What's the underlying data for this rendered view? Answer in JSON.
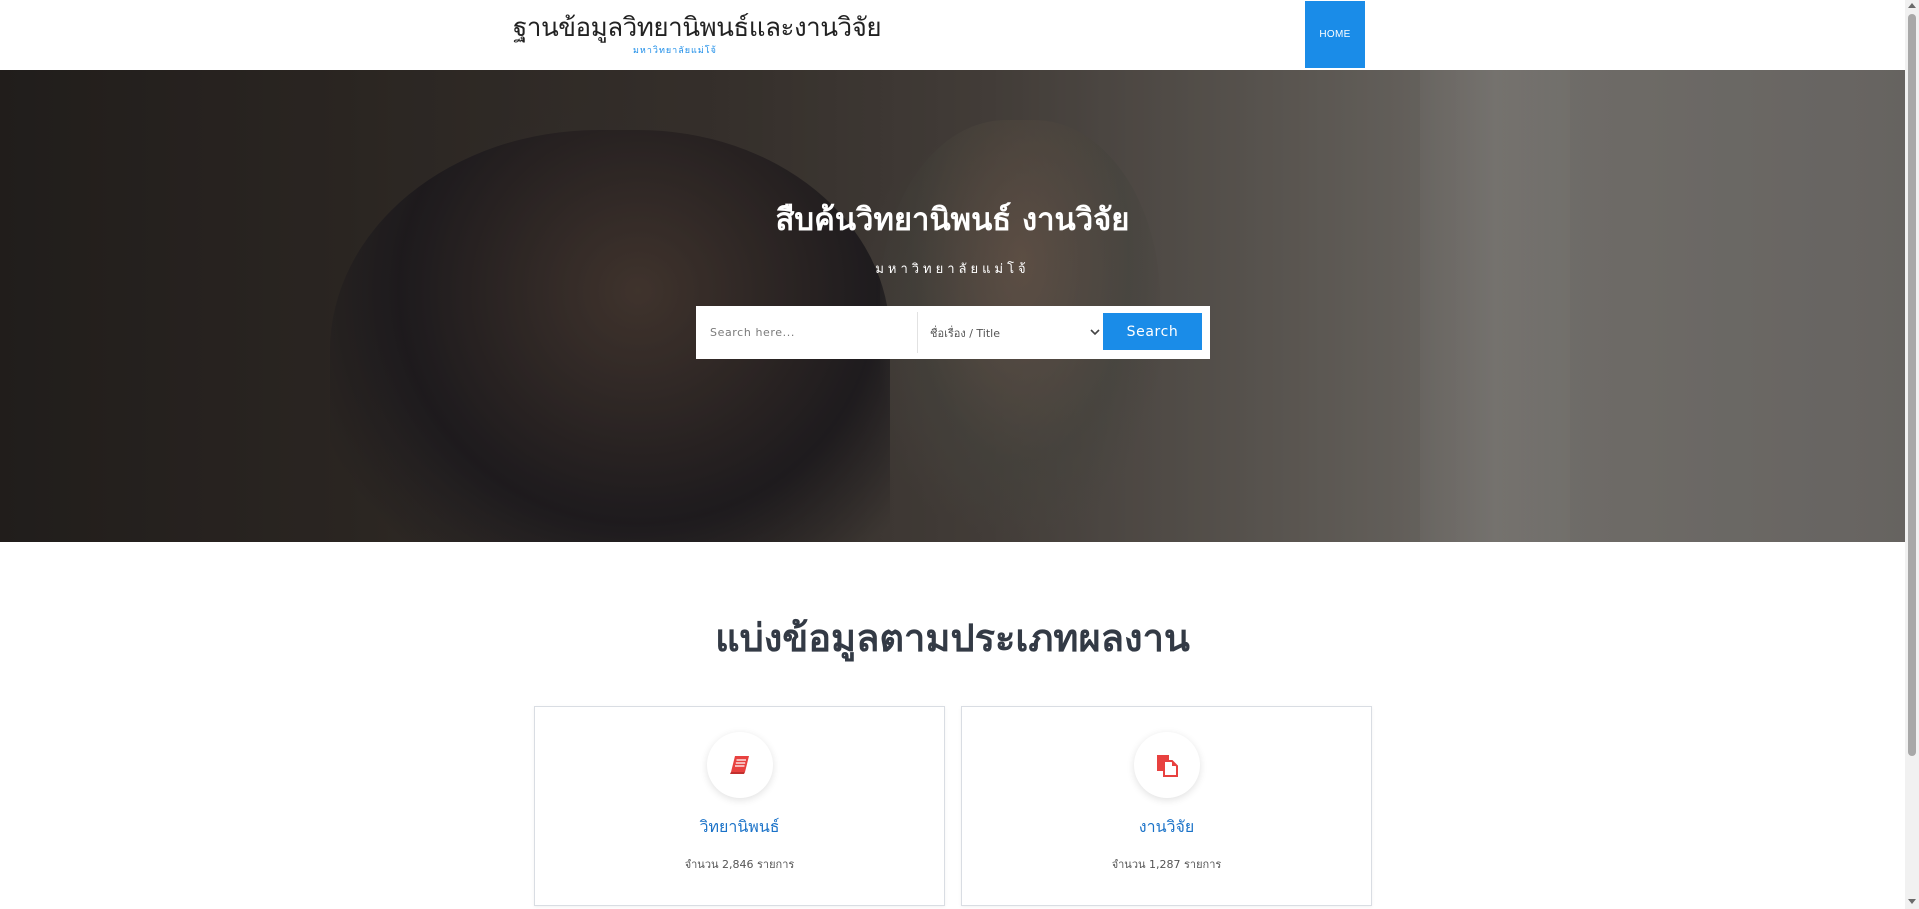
{
  "header": {
    "brand_title": "ฐานข้อมูลวิทยานิพนธ์และงานวิจัย",
    "brand_subtitle": "มหาวิทยาลัยแม่โจ้",
    "nav_home": "HOME"
  },
  "hero": {
    "title": "สืบค้นวิทยานิพนธ์ งานวิจัย",
    "subtitle": "มหาวิทยาลัยแม่โจ้",
    "search_placeholder": "Search here...",
    "search_selected_option": "ชื่อเรื่อง / Title",
    "search_button": "Search"
  },
  "section": {
    "title": "แบ่งข้อมูลตามประเภทผลงาน"
  },
  "cards": [
    {
      "title": "วิทยานิพนธ์",
      "count_text": "จำนวน 2,846 รายการ",
      "icon": "book-icon"
    },
    {
      "title": "งานวิจัย",
      "count_text": "จำนวน 1,287 รายการ",
      "icon": "documents-icon"
    }
  ],
  "colors": {
    "accent": "#1a8ce8",
    "icon_red": "#e8413f",
    "card_title": "#1a72c8"
  }
}
